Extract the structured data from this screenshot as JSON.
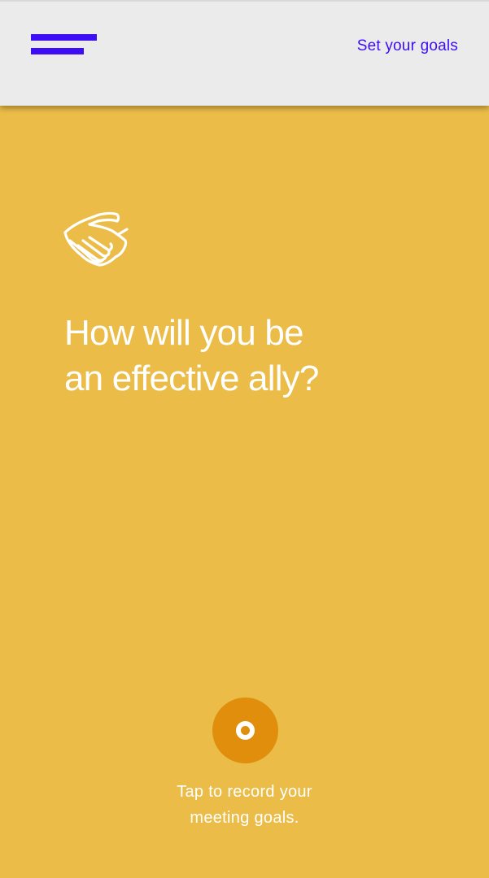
{
  "header": {
    "menu_icon": "hamburger-menu-icon",
    "title": "Set your goals"
  },
  "main": {
    "icon": "handshake-icon",
    "question_line1": "How will you be",
    "question_line2": "an effective ally?"
  },
  "record": {
    "icon": "record-icon",
    "hint_line1": "Tap to record your",
    "hint_line2": "meeting goals."
  },
  "colors": {
    "background": "#ebbd48",
    "header_background": "#ebebeb",
    "accent": "#3d0df5",
    "record_button": "#e08e0b",
    "text_on_background": "#ffffff"
  }
}
